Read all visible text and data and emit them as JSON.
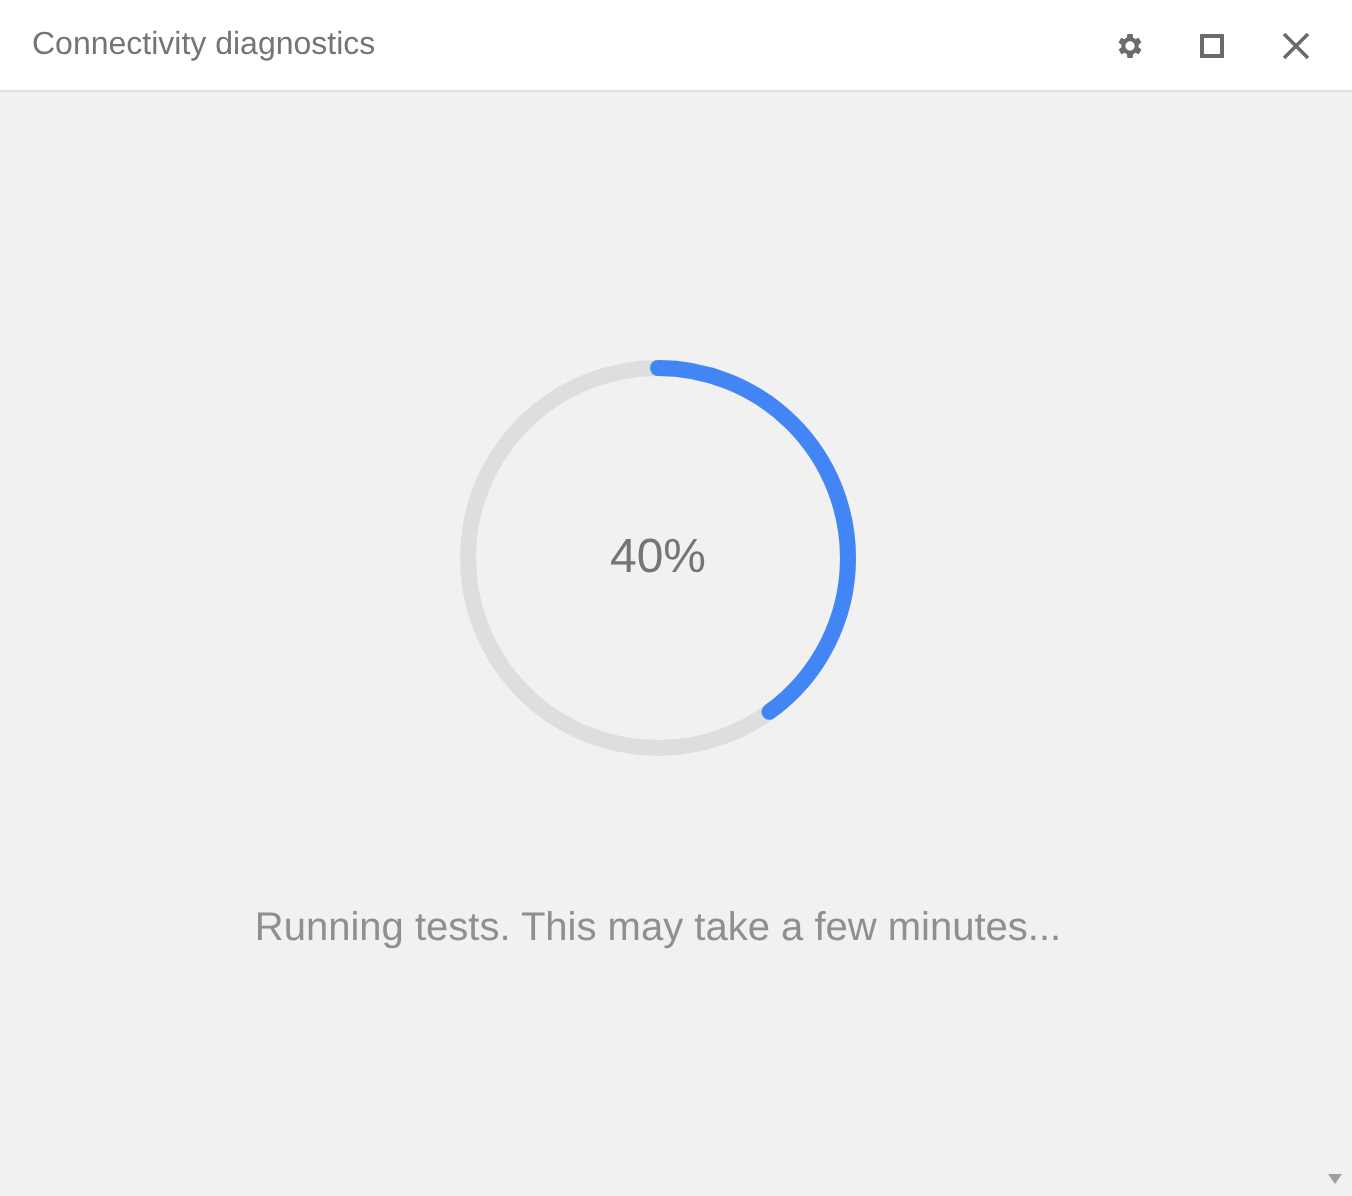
{
  "window": {
    "title": "Connectivity diagnostics"
  },
  "progress": {
    "level": 0.4,
    "reading": "40%"
  },
  "message": "Running tests. This may take a few minutes..."
}
